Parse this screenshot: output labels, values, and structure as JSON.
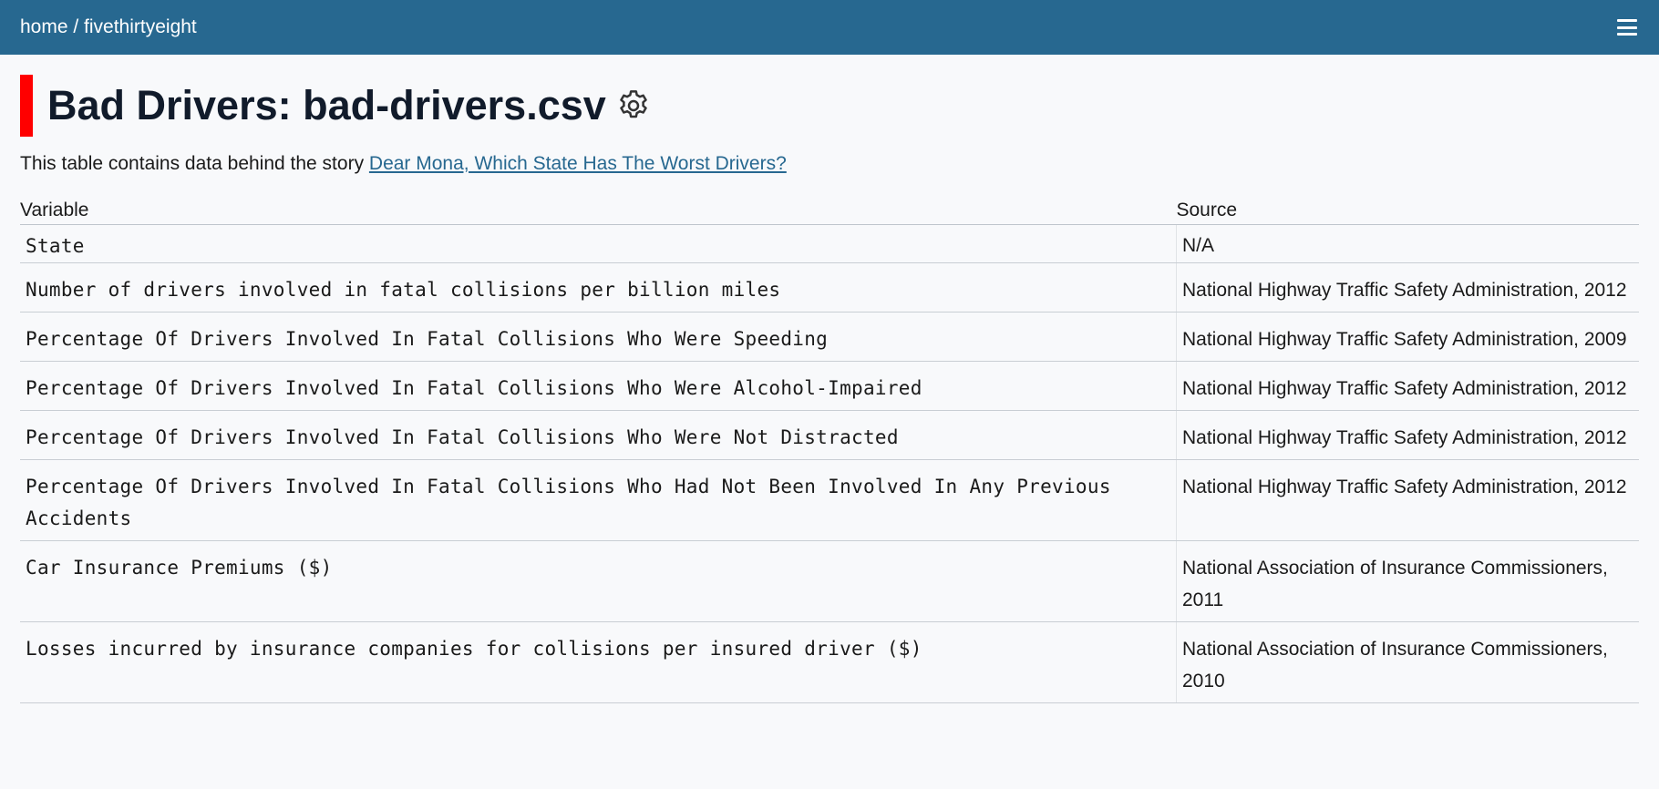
{
  "nav": {
    "breadcrumb_home": "home",
    "breadcrumb_sep": " / ",
    "breadcrumb_current": "fivethirtyeight"
  },
  "page": {
    "title": "Bad Drivers: bad-drivers.csv",
    "intro_text": "This table contains data behind the story ",
    "intro_link": "Dear Mona, Which State Has The Worst Drivers?"
  },
  "table": {
    "headers": [
      "Variable",
      "Source"
    ],
    "rows": [
      {
        "variable": "State",
        "source": "N/A"
      },
      {
        "variable": "Number of drivers involved in fatal collisions per billion miles",
        "source": "National Highway Traffic Safety Administration, 2012"
      },
      {
        "variable": "Percentage Of Drivers Involved In Fatal Collisions Who Were Speeding",
        "source": "National Highway Traffic Safety Administration, 2009"
      },
      {
        "variable": "Percentage Of Drivers Involved In Fatal Collisions Who Were Alcohol-Impaired",
        "source": "National Highway Traffic Safety Administration, 2012"
      },
      {
        "variable": "Percentage Of Drivers Involved In Fatal Collisions Who Were Not Distracted",
        "source": "National Highway Traffic Safety Administration, 2012"
      },
      {
        "variable": "Percentage Of Drivers Involved In Fatal Collisions Who Had Not Been Involved In Any Previous Accidents",
        "source": "National Highway Traffic Safety Administration, 2012"
      },
      {
        "variable": "Car Insurance Premiums ($)",
        "source": "National Association of Insurance Commissioners, 2011"
      },
      {
        "variable": "Losses incurred by insurance companies for collisions per insured driver ($)",
        "source": "National Association of Insurance Commissioners, 2010"
      }
    ]
  },
  "icons": {
    "menu": "hamburger-menu-icon",
    "settings": "gear-icon"
  },
  "colors": {
    "header_bg": "#276890",
    "title_accent": "#ff0000",
    "link": "#276890"
  }
}
